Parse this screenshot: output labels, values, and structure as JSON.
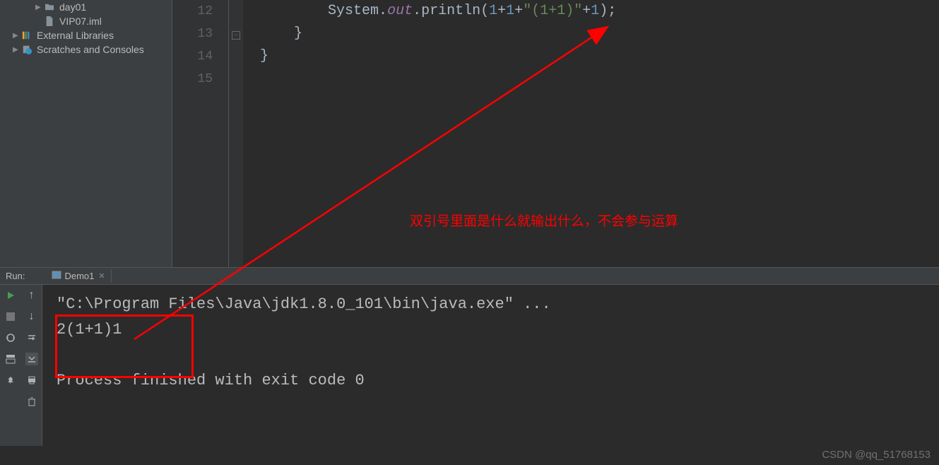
{
  "sidebar": {
    "items": [
      {
        "label": "day01",
        "type": "folder",
        "arrow": "▶"
      },
      {
        "label": "VIP07.iml",
        "type": "file"
      },
      {
        "label": "External Libraries",
        "type": "lib",
        "arrow": "▶"
      },
      {
        "label": "Scratches and Consoles",
        "type": "scratch",
        "arrow": "▶"
      }
    ]
  },
  "editor": {
    "lines": [
      "12",
      "13",
      "14",
      "15"
    ],
    "code": {
      "class": "System",
      "dot1": ".",
      "field": "out",
      "dot2": ".",
      "method": "println",
      "lparen": "(",
      "n1": "1",
      "plus1": "+",
      "n2": "1",
      "plus2": "+",
      "string": "\"(1+1)\"",
      "plus3": "+",
      "n3": "1",
      "rparen": ")",
      "semi": ";",
      "brace1": "}",
      "brace2": "}"
    }
  },
  "annotation": {
    "text": "双引号里面是什么就输出什么，不会参与运算"
  },
  "run": {
    "label": "Run:",
    "tab": "Demo1",
    "output": {
      "line1": "\"C:\\Program Files\\Java\\jdk1.8.0_101\\bin\\java.exe\" ...",
      "line2": "2(1+1)1",
      "line3": "Process finished with exit code 0"
    }
  },
  "watermark": "CSDN @qq_51768153"
}
